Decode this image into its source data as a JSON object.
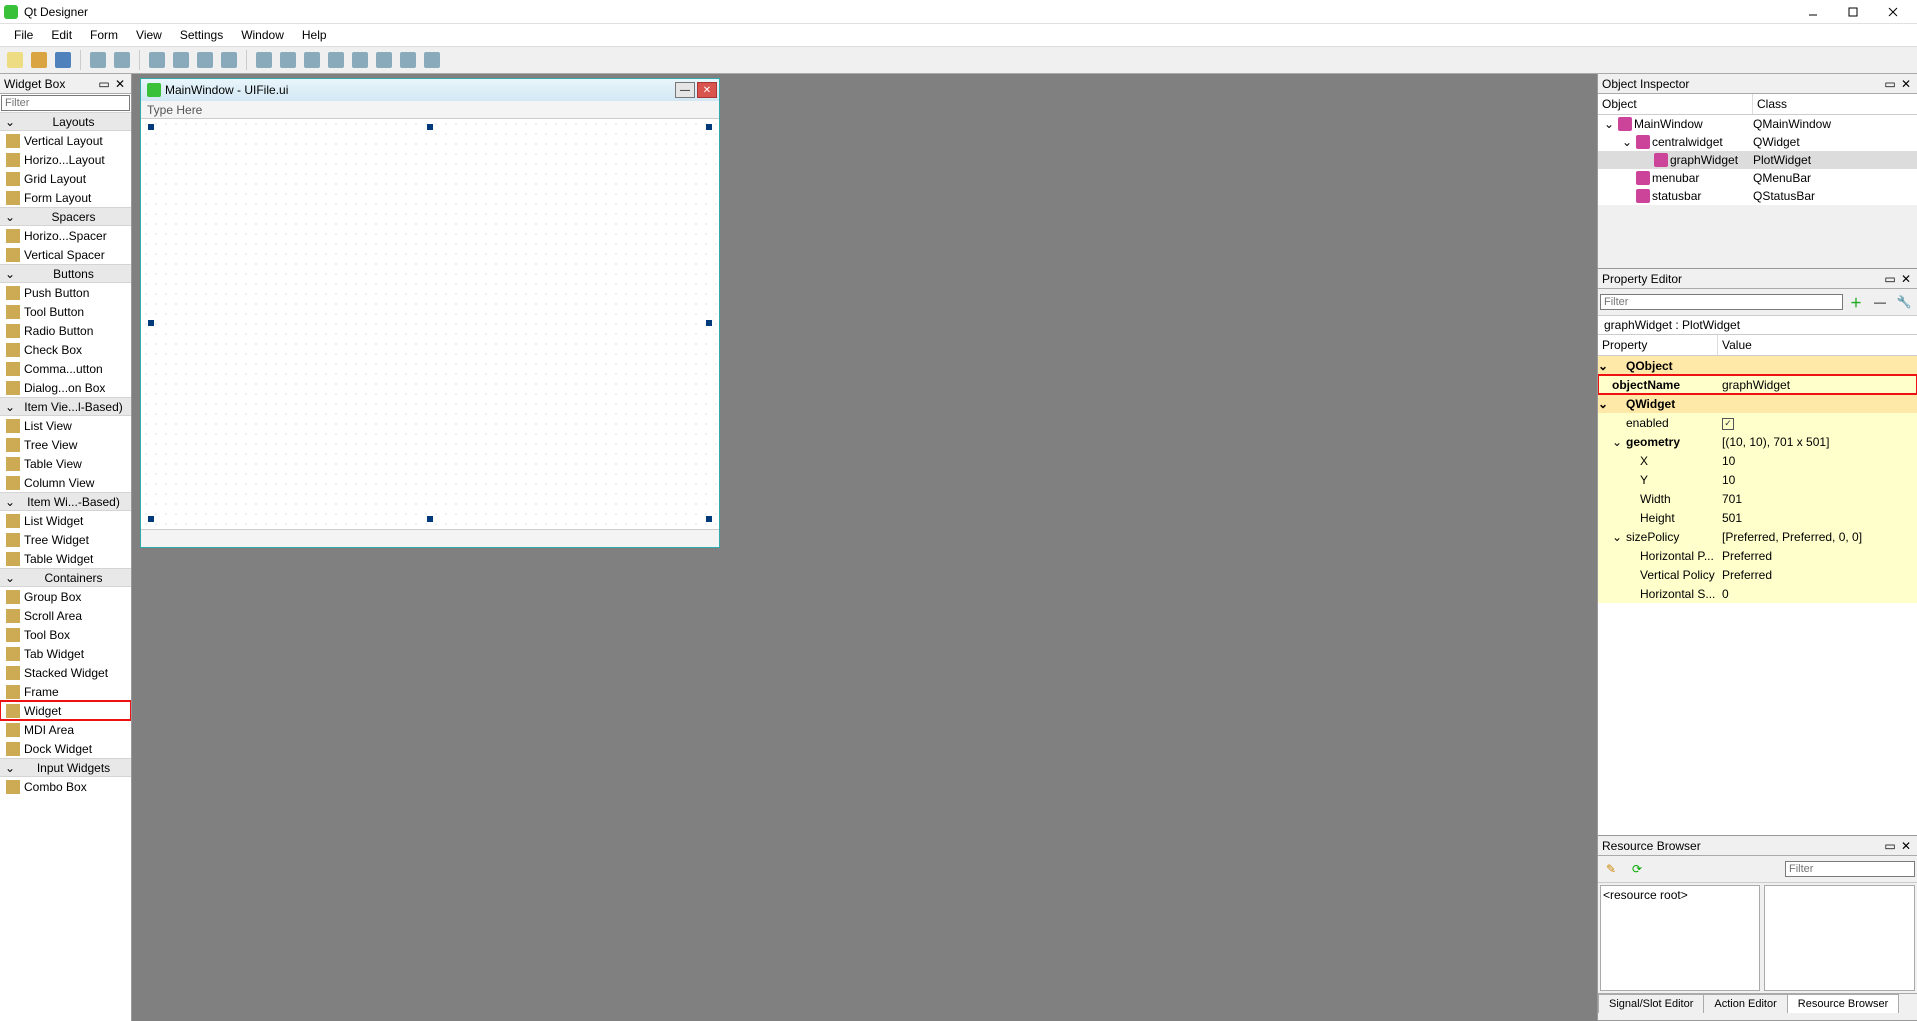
{
  "app": {
    "title": "Qt Designer"
  },
  "menubar": [
    "File",
    "Edit",
    "Form",
    "View",
    "Settings",
    "Window",
    "Help"
  ],
  "toolbar_icons": [
    "new-file-icon",
    "open-file-icon",
    "save-file-icon",
    "|",
    "send-to-back-icon",
    "bring-to-front-icon",
    "|",
    "edit-widgets-icon",
    "edit-signals-icon",
    "edit-buddies-icon",
    "edit-tab-order-icon",
    "|",
    "layout-h-icon",
    "layout-v-icon",
    "layout-hsplit-icon",
    "layout-vsplit-icon",
    "layout-grid-icon",
    "layout-form-icon",
    "break-layout-icon",
    "adjust-size-icon"
  ],
  "widgetBox": {
    "title": "Widget Box",
    "filter_placeholder": "Filter",
    "categories": [
      {
        "name": "Layouts",
        "items": [
          "Vertical Layout",
          "Horizo...Layout",
          "Grid Layout",
          "Form Layout"
        ]
      },
      {
        "name": "Spacers",
        "items": [
          "Horizo...Spacer",
          "Vertical Spacer"
        ]
      },
      {
        "name": "Buttons",
        "items": [
          "Push Button",
          "Tool Button",
          "Radio Button",
          "Check Box",
          "Comma...utton",
          "Dialog...on Box"
        ]
      },
      {
        "name": "Item Vie...l-Based)",
        "items": [
          "List View",
          "Tree View",
          "Table View",
          "Column View"
        ]
      },
      {
        "name": "Item Wi...-Based)",
        "items": [
          "List Widget",
          "Tree Widget",
          "Table Widget"
        ]
      },
      {
        "name": "Containers",
        "items": [
          "Group Box",
          "Scroll Area",
          "Tool Box",
          "Tab Widget",
          "Stacked Widget",
          "Frame",
          "Widget",
          "MDI Area",
          "Dock Widget"
        ]
      },
      {
        "name": "Input Widgets",
        "items": [
          "Combo Box"
        ]
      }
    ],
    "highlighted_item": "Widget"
  },
  "formWindow": {
    "title": "MainWindow - UIFile.ui",
    "menubar_text": "Type Here"
  },
  "objectInspector": {
    "title": "Object Inspector",
    "cols": [
      "Object",
      "Class"
    ],
    "rows": [
      {
        "object": "MainWindow",
        "klass": "QMainWindow",
        "depth": 0,
        "expand": true
      },
      {
        "object": "centralwidget",
        "klass": "QWidget",
        "depth": 1,
        "expand": true
      },
      {
        "object": "graphWidget",
        "klass": "PlotWidget",
        "depth": 2,
        "selected": true
      },
      {
        "object": "menubar",
        "klass": "QMenuBar",
        "depth": 1
      },
      {
        "object": "statusbar",
        "klass": "QStatusBar",
        "depth": 1
      }
    ]
  },
  "propertyEditor": {
    "title": "Property Editor",
    "filter_placeholder": "Filter",
    "scope": "graphWidget : PlotWidget",
    "cols": [
      "Property",
      "Value"
    ],
    "rows": [
      {
        "type": "group",
        "label": "QObject"
      },
      {
        "prop": "objectName",
        "value": "graphWidget",
        "bold": true,
        "highlighted": true
      },
      {
        "type": "group",
        "label": "QWidget"
      },
      {
        "prop": "enabled",
        "value": "",
        "chk": true,
        "indent": 1
      },
      {
        "prop": "geometry",
        "value": "[(10, 10), 701 x 501]",
        "bold": true,
        "expand": true,
        "indent": 0
      },
      {
        "prop": "X",
        "value": "10",
        "indent": 2
      },
      {
        "prop": "Y",
        "value": "10",
        "indent": 2
      },
      {
        "prop": "Width",
        "value": "701",
        "indent": 2
      },
      {
        "prop": "Height",
        "value": "501",
        "indent": 2
      },
      {
        "prop": "sizePolicy",
        "value": "[Preferred, Preferred, 0, 0]",
        "expand": true,
        "indent": 0
      },
      {
        "prop": "Horizontal P...",
        "value": "Preferred",
        "indent": 2
      },
      {
        "prop": "Vertical Policy",
        "value": "Preferred",
        "indent": 2
      },
      {
        "prop": "Horizontal S...",
        "value": "0",
        "indent": 2
      }
    ]
  },
  "resourceBrowser": {
    "title": "Resource Browser",
    "filter_placeholder": "Filter",
    "tree_root": "<resource root>",
    "tabs": [
      "Signal/Slot Editor",
      "Action Editor",
      "Resource Browser"
    ],
    "active_tab": 2
  }
}
